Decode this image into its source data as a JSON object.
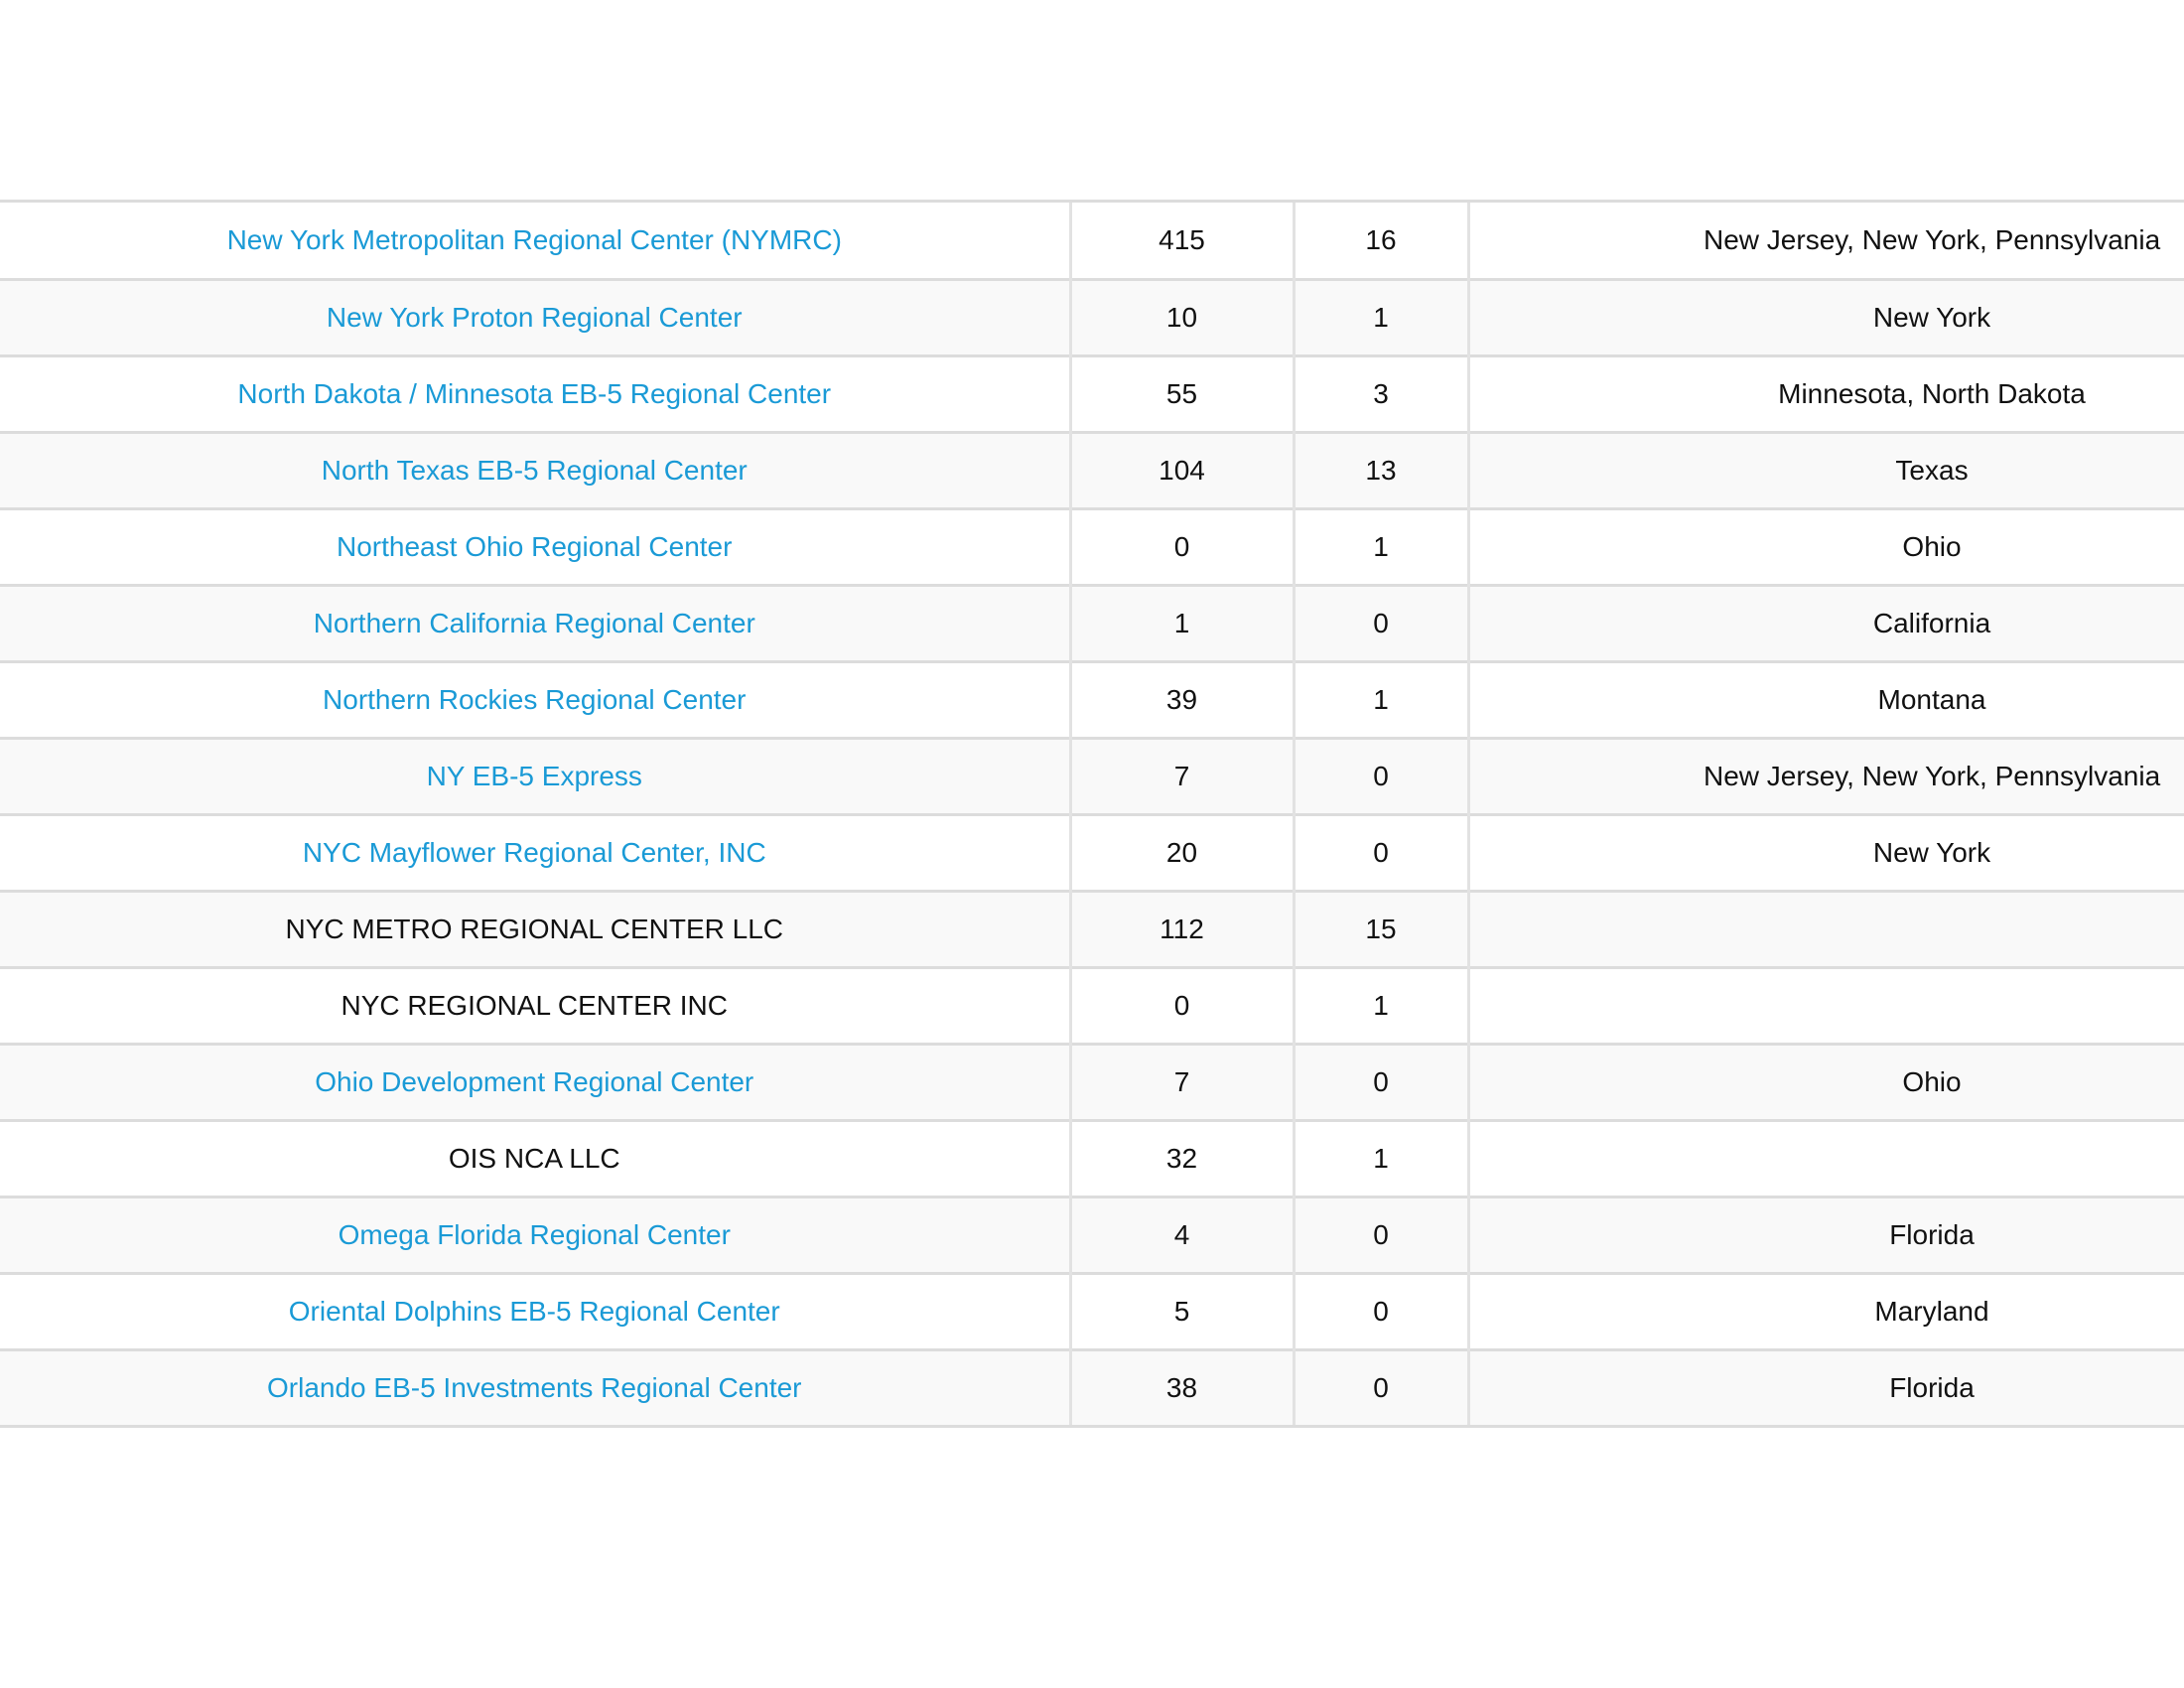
{
  "link_color": "#1a9ad6",
  "table": {
    "rows": [
      {
        "name": "New York Metropolitan Regional Center (NYMRC)",
        "is_link": true,
        "value1": "415",
        "value2": "16",
        "states": "New Jersey, New York, Pennsylvania"
      },
      {
        "name": "New York Proton Regional Center",
        "is_link": true,
        "value1": "10",
        "value2": "1",
        "states": "New York"
      },
      {
        "name": "North Dakota / Minnesota EB-5 Regional Center",
        "is_link": true,
        "value1": "55",
        "value2": "3",
        "states": "Minnesota, North Dakota"
      },
      {
        "name": "North Texas EB-5 Regional Center",
        "is_link": true,
        "value1": "104",
        "value2": "13",
        "states": "Texas"
      },
      {
        "name": "Northeast Ohio Regional Center",
        "is_link": true,
        "value1": "0",
        "value2": "1",
        "states": "Ohio"
      },
      {
        "name": "Northern California Regional Center",
        "is_link": true,
        "value1": "1",
        "value2": "0",
        "states": "California"
      },
      {
        "name": "Northern Rockies Regional Center",
        "is_link": true,
        "value1": "39",
        "value2": "1",
        "states": "Montana"
      },
      {
        "name": "NY EB-5 Express",
        "is_link": true,
        "value1": "7",
        "value2": "0",
        "states": "New Jersey, New York, Pennsylvania"
      },
      {
        "name": "NYC Mayflower Regional Center, INC",
        "is_link": true,
        "value1": "20",
        "value2": "0",
        "states": "New York"
      },
      {
        "name": "NYC METRO REGIONAL CENTER LLC",
        "is_link": false,
        "value1": "112",
        "value2": "15",
        "states": ""
      },
      {
        "name": "NYC REGIONAL CENTER INC",
        "is_link": false,
        "value1": "0",
        "value2": "1",
        "states": ""
      },
      {
        "name": "Ohio Development Regional Center",
        "is_link": true,
        "value1": "7",
        "value2": "0",
        "states": "Ohio"
      },
      {
        "name": "OIS NCA LLC",
        "is_link": false,
        "value1": "32",
        "value2": "1",
        "states": ""
      },
      {
        "name": "Omega Florida Regional Center",
        "is_link": true,
        "value1": "4",
        "value2": "0",
        "states": "Florida"
      },
      {
        "name": "Oriental Dolphins EB-5 Regional Center",
        "is_link": true,
        "value1": "5",
        "value2": "0",
        "states": "Maryland"
      },
      {
        "name": "Orlando EB-5 Investments Regional Center",
        "is_link": true,
        "value1": "38",
        "value2": "0",
        "states": "Florida"
      }
    ]
  }
}
